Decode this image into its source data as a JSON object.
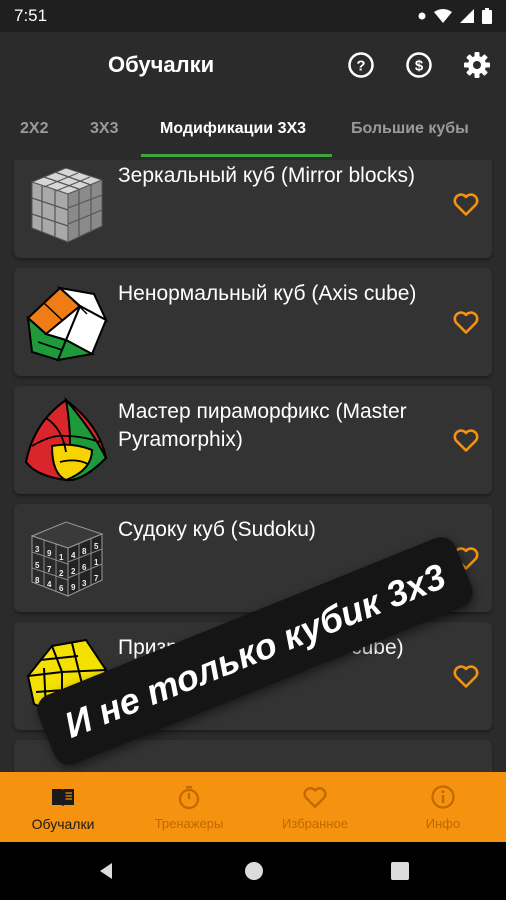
{
  "status": {
    "time": "7:51"
  },
  "appbar": {
    "title": "Обучалки"
  },
  "tabs": [
    "2X2",
    "3X3",
    "Модификации 3X3",
    "Большие кубы"
  ],
  "items": [
    {
      "name": "Зеркальный куб (Mirror blocks)"
    },
    {
      "name": "Ненормальный куб (Axis cube)"
    },
    {
      "name": "Мастер пираморфикс (Master Pyramorphix)"
    },
    {
      "name": "Судоку куб (Sudoku)"
    },
    {
      "name": "Призрачный куб (Ghost cube)"
    }
  ],
  "overlay": {
    "text": "И не только кубик 3x3"
  },
  "nav": [
    {
      "label": "Обучалки",
      "icon": "book-icon"
    },
    {
      "label": "Тренажеры",
      "icon": "stopwatch-icon"
    },
    {
      "label": "Избранное",
      "icon": "heart-icon"
    },
    {
      "label": "Инфо",
      "icon": "info-icon"
    }
  ],
  "colors": {
    "accent": "#f5920f",
    "tab_indicator": "#3ea53e",
    "heart": "#f5920f",
    "background": "#2b2b2b"
  }
}
